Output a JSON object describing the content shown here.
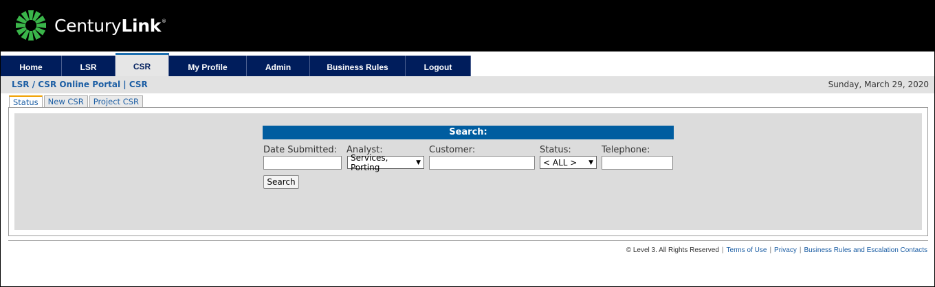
{
  "brand": {
    "name_regular": "Century",
    "name_bold": "Link",
    "trademark": "®",
    "colors": {
      "header_bg": "#000000",
      "logo_green": "#3ab54a",
      "nav_bg": "#001d5c",
      "accent_blue": "#005da0"
    }
  },
  "nav": {
    "tabs": [
      {
        "label": "Home"
      },
      {
        "label": "LSR"
      },
      {
        "label": "CSR"
      },
      {
        "label": "My Profile"
      },
      {
        "label": "Admin"
      },
      {
        "label": "Business Rules"
      },
      {
        "label": "Logout"
      }
    ],
    "active": "CSR"
  },
  "breadcrumb": {
    "text": "LSR / CSR Online Portal | CSR"
  },
  "date": "Sunday, March 29, 2020",
  "subtabs": {
    "items": [
      {
        "label": "Status"
      },
      {
        "label": "New CSR"
      },
      {
        "label": "Project CSR"
      }
    ],
    "active": "Status"
  },
  "search": {
    "title": "Search:",
    "fields": {
      "date_submitted": {
        "label": "Date Submitted:",
        "value": ""
      },
      "analyst": {
        "label": "Analyst:",
        "value": "Services, Porting"
      },
      "customer": {
        "label": "Customer:",
        "value": ""
      },
      "status": {
        "label": "Status:",
        "value": "< ALL >"
      },
      "telephone": {
        "label": "Telephone:",
        "value": ""
      }
    },
    "button_label": "Search"
  },
  "footer": {
    "copyright": "© Level 3. All Rights Reserved",
    "separator": "|",
    "links": [
      {
        "label": "Terms of Use"
      },
      {
        "label": "Privacy"
      },
      {
        "label": "Business Rules and Escalation Contacts"
      }
    ]
  }
}
